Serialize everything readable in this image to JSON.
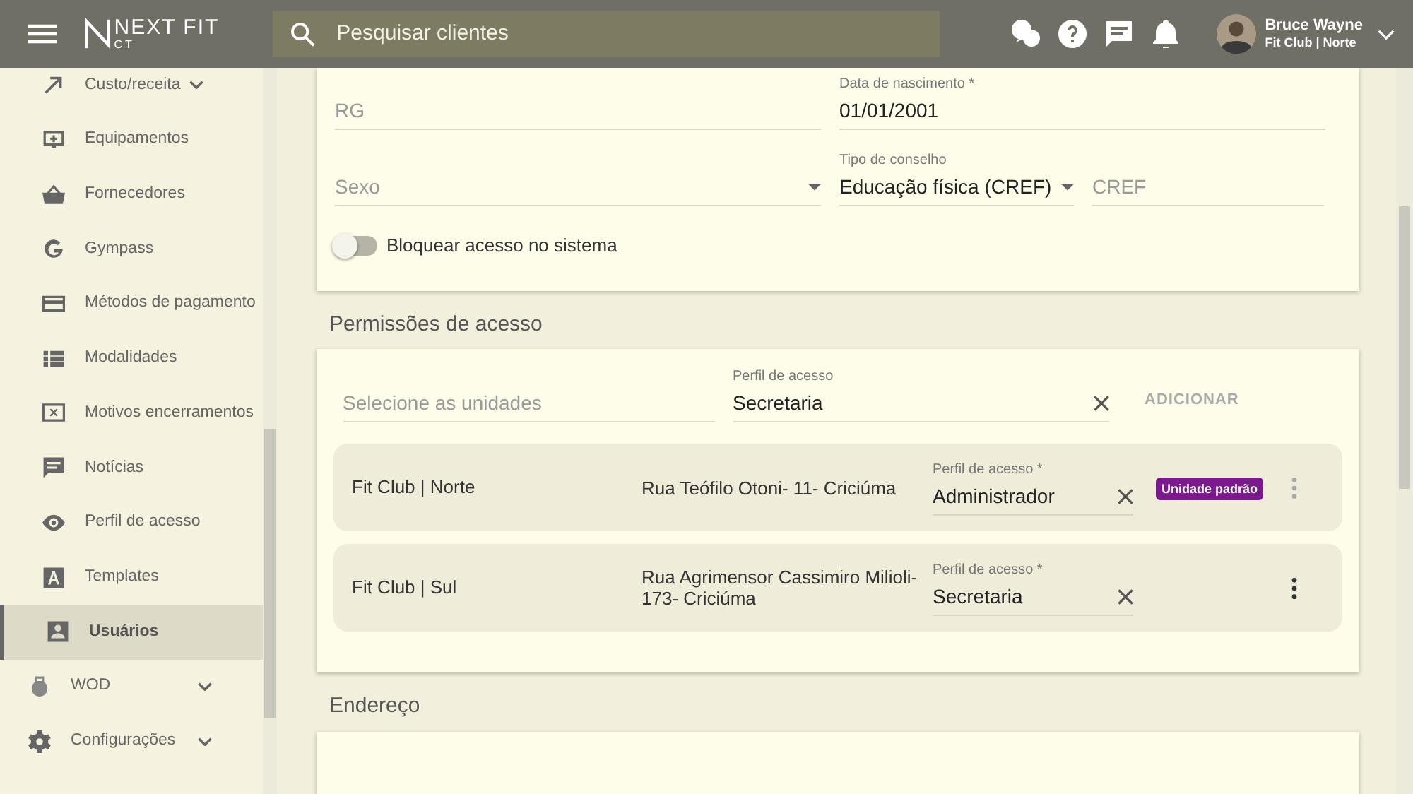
{
  "header": {
    "logo_text": "NEXT FIT",
    "logo_sub": "CT",
    "search": {
      "placeholder": "Pesquisar clientes"
    },
    "user": {
      "name": "Bruce Wayne",
      "unit": "Fit Club | Norte"
    }
  },
  "sidebar": {
    "submenu_items": [
      {
        "label": "Custo/receita",
        "expandable": true,
        "selected": false
      },
      {
        "label": "Equipamentos",
        "expandable": false,
        "selected": false
      },
      {
        "label": "Fornecedores",
        "expandable": false,
        "selected": false
      },
      {
        "label": "Gympass",
        "expandable": false,
        "selected": false
      },
      {
        "label": "Métodos de pagamento",
        "expandable": false,
        "selected": false
      },
      {
        "label": "Modalidades",
        "expandable": false,
        "selected": false
      },
      {
        "label": "Motivos encerramentos",
        "expandable": false,
        "selected": false
      },
      {
        "label": "Notícias",
        "expandable": false,
        "selected": false
      },
      {
        "label": "Perfil de acesso",
        "expandable": false,
        "selected": false
      },
      {
        "label": "Templates",
        "expandable": false,
        "selected": false
      },
      {
        "label": "Usuários",
        "expandable": false,
        "selected": true
      }
    ],
    "items": [
      {
        "label": "WOD",
        "expandable": true,
        "selected": false
      },
      {
        "label": "Configurações",
        "expandable": true,
        "selected": false
      }
    ]
  },
  "form": {
    "rows": [
      [
        {
          "placeholder": "RG",
          "select": false
        },
        {
          "label": "Data de nascimento *",
          "value": "01/01/2001",
          "select": false
        }
      ],
      [
        {
          "placeholder": "Sexo",
          "select": true
        },
        {
          "label": "Tipo de conselho",
          "value": "Educação física (CREF)",
          "select": true
        },
        {
          "placeholder": "CREF",
          "select": false
        }
      ]
    ],
    "toggle": {
      "label": "Bloquear acesso no sistema",
      "on": false
    }
  },
  "permissions": {
    "title": "Permissões de acesso",
    "unit_select": {
      "placeholder": "Selecione as unidades"
    },
    "profile": {
      "label": "Perfil de acesso",
      "value": "Secretaria"
    },
    "add_button": {
      "label": "ADICIONAR",
      "disabled": true
    },
    "units": [
      {
        "name": "Fit Club | Norte",
        "address": "Rua Teófilo Otoni- 11- Criciúma",
        "profile_label": "Perfil de acesso *",
        "profile": "Administrador",
        "badge": "Unidade padrão"
      },
      {
        "name": "Fit Club | Sul",
        "address": "Rua Agrimensor Cassimiro Milioli- 173- Criciúma",
        "profile_label": "Perfil de acesso *",
        "profile": "Secretaria"
      }
    ]
  },
  "address": {
    "title": "Endereço"
  }
}
